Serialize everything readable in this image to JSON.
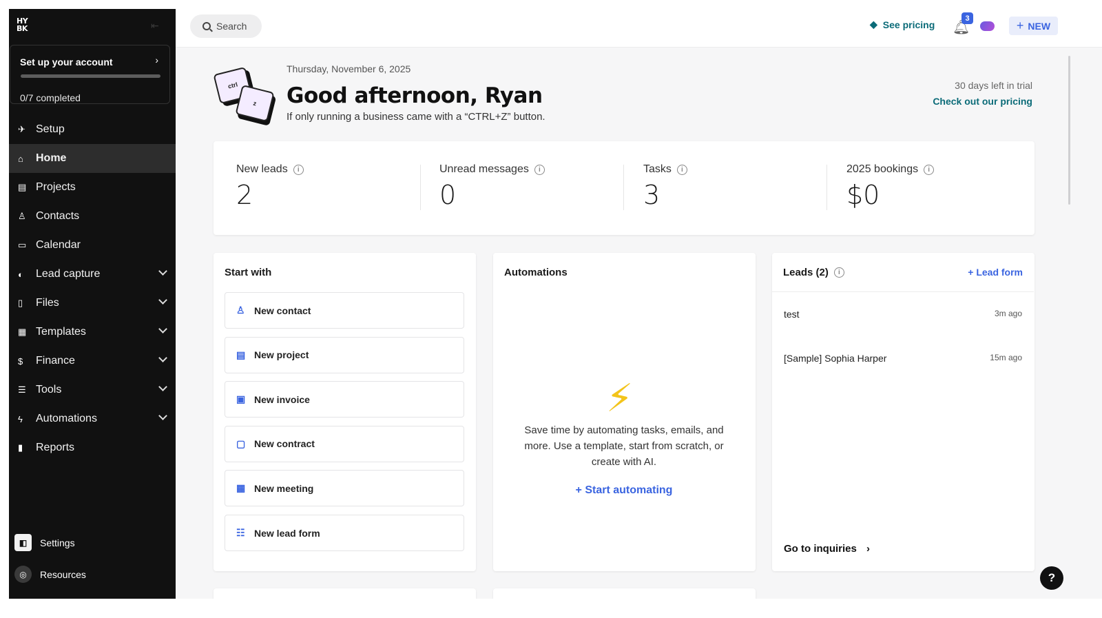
{
  "sidebar": {
    "logo_line1": "HY",
    "logo_line2": "BK",
    "setup": {
      "title": "Set up your account",
      "progress_text": "0/7 completed",
      "progress": 0
    },
    "items": [
      {
        "label": "Setup",
        "icon": "rocket-icon"
      },
      {
        "label": "Home",
        "icon": "home-icon",
        "active": true
      },
      {
        "label": "Projects",
        "icon": "briefcase-icon"
      },
      {
        "label": "Contacts",
        "icon": "person-icon"
      },
      {
        "label": "Calendar",
        "icon": "calendar-icon"
      },
      {
        "label": "Lead capture",
        "icon": "capture-icon",
        "expandable": true
      },
      {
        "label": "Files",
        "icon": "file-icon",
        "expandable": true
      },
      {
        "label": "Templates",
        "icon": "template-icon",
        "expandable": true
      },
      {
        "label": "Finance",
        "icon": "dollar-icon",
        "expandable": true
      },
      {
        "label": "Tools",
        "icon": "list-icon",
        "expandable": true
      },
      {
        "label": "Automations",
        "icon": "bolt-icon",
        "expandable": true
      },
      {
        "label": "Reports",
        "icon": "bar-chart-icon"
      }
    ],
    "settings_label": "Settings",
    "resources_label": "Resources"
  },
  "topbar": {
    "search_label": "Search",
    "pricing_label": "See pricing",
    "notifications_count": "3",
    "new_label": "NEW"
  },
  "header": {
    "date": "Thursday, November 6, 2025",
    "greeting": "Good afternoon, Ryan",
    "tagline": "If only running a business came with a “CTRL+Z” button.",
    "key1": "ctrl",
    "key2": "z",
    "trial_text": "30 days left in trial",
    "trial_link": "Check out our pricing"
  },
  "stats": [
    {
      "label": "New leads",
      "value": "2"
    },
    {
      "label": "Unread messages",
      "value": "0"
    },
    {
      "label": "Tasks",
      "value": "3"
    },
    {
      "label": "2025 bookings",
      "value": "$0"
    }
  ],
  "start_with": {
    "title": "Start with",
    "items": [
      {
        "label": "New contact",
        "icon": "person-icon"
      },
      {
        "label": "New project",
        "icon": "briefcase-icon"
      },
      {
        "label": "New invoice",
        "icon": "invoice-icon"
      },
      {
        "label": "New contract",
        "icon": "contract-icon"
      },
      {
        "label": "New meeting",
        "icon": "calendar-icon"
      },
      {
        "label": "New lead form",
        "icon": "form-icon"
      }
    ]
  },
  "automations": {
    "title": "Automations",
    "description": "Save time by automating tasks, emails, and more. Use a template, start from scratch, or create with AI.",
    "link": "+ Start automating"
  },
  "leads": {
    "title": "Leads (2)",
    "action": "+ Lead form",
    "rows": [
      {
        "name": "test",
        "ago": "3m ago"
      },
      {
        "name": "[Sample] Sophia Harper",
        "ago": "15m ago"
      }
    ],
    "footer_link": "Go to inquiries"
  },
  "colors": {
    "accent": "#3a64e0",
    "teal": "#0b6b78",
    "sidebar": "#111111"
  }
}
